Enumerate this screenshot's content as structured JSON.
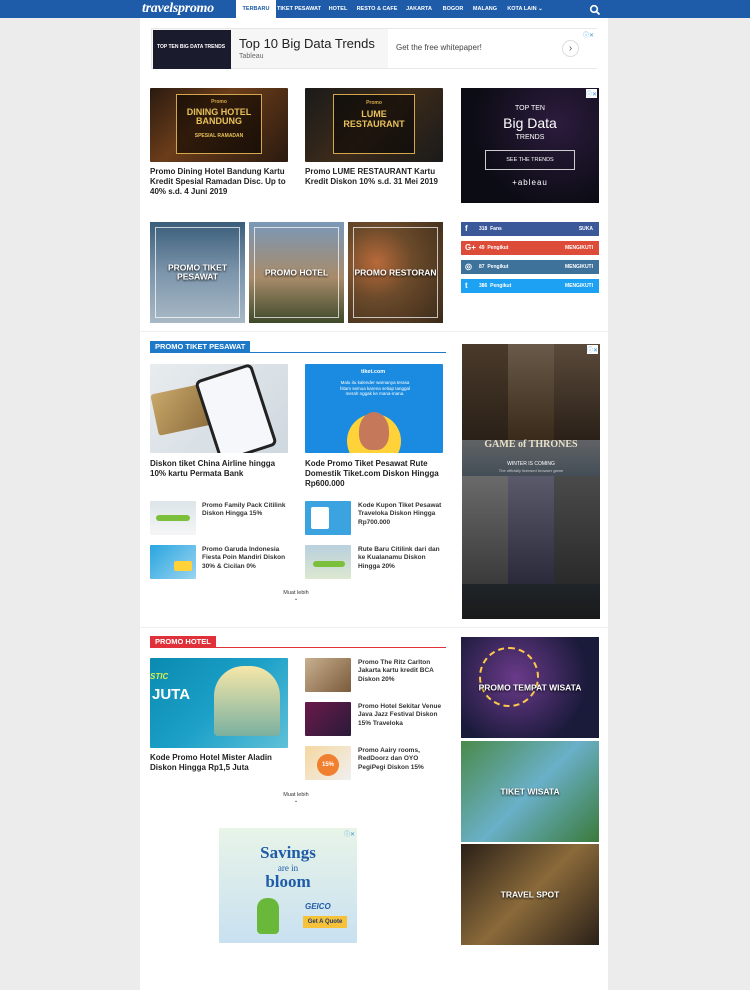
{
  "header": {
    "logo": "travelspromo",
    "nav": [
      "TERBARU",
      "TIKET PESAWAT",
      "HOTEL",
      "RESTO & CAFE",
      "JAKARTA",
      "BOGOR",
      "MALANG",
      "KOTA LAIN ⌄"
    ],
    "active": "TERBARU"
  },
  "top_ad": {
    "badge": "TOP TEN BIG DATA TRENDS",
    "title": "Top 10 Big Data Trends",
    "source": "Tableau",
    "cta": "Get the free whitepaper!"
  },
  "featured": [
    {
      "img_tag": "Promo",
      "img_title": "DINING HOTEL BANDUNG",
      "img_sub": "SPESIAL RAMADAN",
      "caption": "Promo Dining Hotel Bandung Kartu Kredit Spesial Ramadan Disc. Up to 40% s.d. 4 Juni 2019"
    },
    {
      "img_tag": "Promo",
      "img_title": "LUME RESTAURANT",
      "img_sub": "",
      "caption": "Promo LUME RESTAURANT Kartu Kredit Diskon 10% s.d. 31 Mei 2019"
    }
  ],
  "side_ad_1": {
    "line1": "TOP TEN",
    "line2": "Big Data",
    "line3": "TRENDS",
    "button": "SEE THE TRENDS",
    "brand": "+ableau"
  },
  "category_tiles": [
    "PROMO TIKET PESAWAT",
    "PROMO HOTEL",
    "PROMO RESTORAN"
  ],
  "social": [
    {
      "icon": "f",
      "count": "318",
      "unit": "Fans",
      "action": "SUKA",
      "color": "#3b5998"
    },
    {
      "icon": "G+",
      "count": "49",
      "unit": "Pengikut",
      "action": "MENGIKUTI",
      "color": "#dd4b39"
    },
    {
      "icon": "◎",
      "count": "87",
      "unit": "Pengikut",
      "action": "MENGIKUTI",
      "color": "#3f729b"
    },
    {
      "icon": "t",
      "count": "386",
      "unit": "Pengikut",
      "action": "MENGIKUTI",
      "color": "#1da1f2"
    }
  ],
  "section_flight": {
    "badge": "PROMO TIKET PESAWAT",
    "big": [
      {
        "caption": "Diskon tiket China Airline hingga 10% kartu Permata Bank"
      },
      {
        "caption": "Kode Promo Tiket Pesawat Rute Domestik Tiket.com Diskon Hingga Rp600.000",
        "img_brand": "tiket.com",
        "img_text": "Malu itu kalender warnanya terasa hitam semua karena setiap tanggal merah nggak ke mana-mana."
      }
    ],
    "small": [
      "Promo Family Pack Citilink Diskon Hingga 15%",
      "Kode Kupon Tiket Pesawat Traveloka Diskon Hingga Rp700.000",
      "Promo Garuda Indonesia Fiesta Poin Mandiri Diskon 30% & Cicilan 0%",
      "Rute Baru Citilink dari dan ke Kualanamu Diskon Hingga 20%"
    ],
    "more": "Muat lebih"
  },
  "side_ad_2": {
    "title": "GAME of THRONES",
    "sub": "WINTER IS COMING",
    "sub2": "The officially licensed browser game"
  },
  "section_hotel": {
    "badge": "PROMO HOTEL",
    "big": {
      "caption": "Kode Promo Hotel Mister Aladin Diskon Hingga Rp1,5 Juta",
      "img_text1": "STIC",
      "img_text2": "JUTA"
    },
    "small": [
      "Promo The Ritz Carlton Jakarta kartu kredit BCA Diskon 20%",
      "Promo Hotel Sekitar Venue Java Jazz Festival Diskon 15% Traveloka",
      "Promo Aairy rooms, RedDoorz dan OYO PegiPegi Diskon 15%"
    ],
    "badge15": "15%",
    "more": "Muat lebih"
  },
  "side_tiles": [
    "PROMO TEMPAT WISATA",
    "TIKET WISATA",
    "TRAVEL SPOT"
  ],
  "bottom_ad": {
    "line1": "Savings",
    "line2": "are in",
    "line3": "bloom",
    "brand": "GEICO",
    "cta": "Get A Quote"
  }
}
